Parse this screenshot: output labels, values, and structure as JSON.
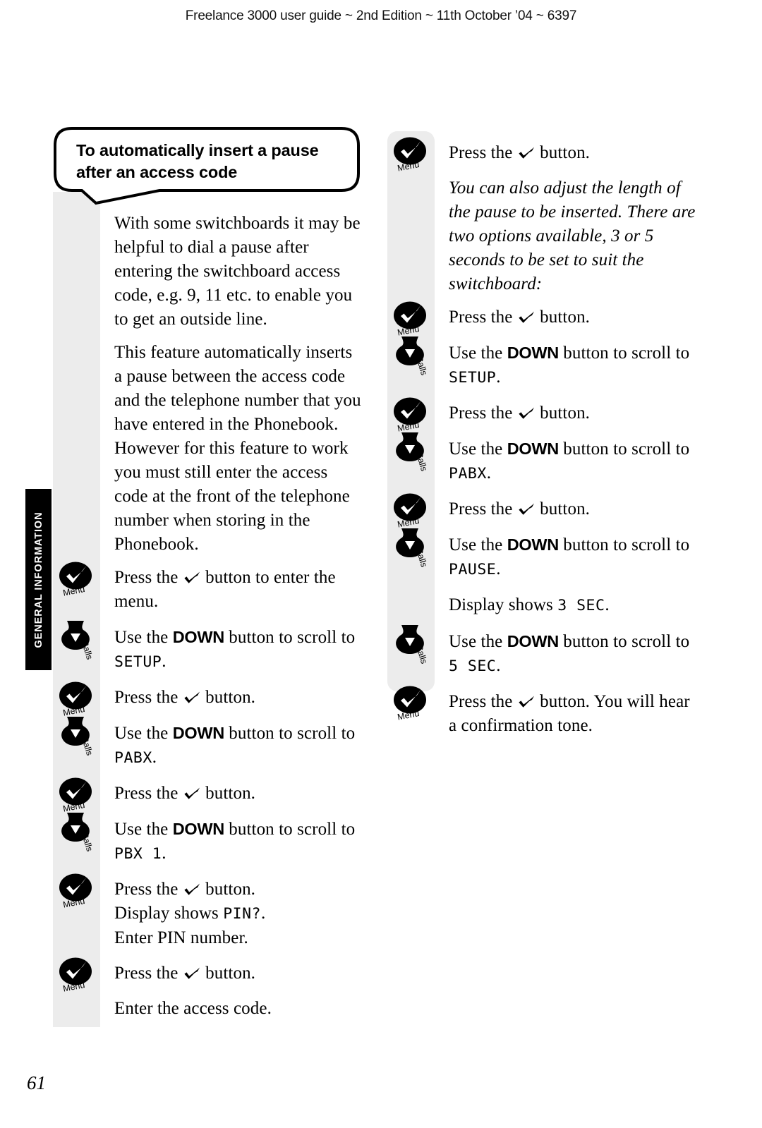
{
  "header": {
    "running_head": "Freelance 3000 user guide ~ 2nd Edition ~ 11th October ’04 ~ 6397"
  },
  "section_tab": {
    "label": "GENERAL INFORMATION"
  },
  "callout": {
    "title": "To automatically insert a pause after an access code"
  },
  "icons": {
    "menu": {
      "name": "menu-tick-icon",
      "caption": "Menu"
    },
    "down": {
      "name": "down-arrow-icon",
      "caption": "Calls"
    }
  },
  "left_column": {
    "intro_1": "With some switchboards it may be helpful to dial a pause after entering the switchboard access code, e.g. 9, 11 etc. to enable you to get an outside line.",
    "intro_2": "This feature automatically inserts a pause between the access code and the telephone number that you have entered in the Phonebook. However for this feature to work you must still enter the access code at the front of the telephone number when storing in the Phonebook.",
    "steps": [
      {
        "icon": "menu",
        "pre": "Press the ",
        "post": " button to enter the menu."
      },
      {
        "icon": "down",
        "pre": "Use the ",
        "bold": "DOWN",
        "post": " button to scroll to ",
        "lcd": "SETUP",
        "tail": "."
      },
      {
        "icon": "menu",
        "pre": "Press the ",
        "post": " button."
      },
      {
        "icon": "down",
        "pre": "Use the ",
        "bold": "DOWN",
        "post": " button to scroll to ",
        "lcd": "PABX",
        "tail": "."
      },
      {
        "icon": "menu",
        "pre": "Press the ",
        "post": " button."
      },
      {
        "icon": "down",
        "pre": "Use the ",
        "bold": "DOWN",
        "post": " button to scroll to ",
        "lcd": "PBX  1",
        "tail": "."
      },
      {
        "icon": "menu",
        "pre": "Press the ",
        "post": " button.",
        "line2_pre": "Display shows ",
        "line2_lcd": "PIN?",
        "line2_tail": ".",
        "line3": "Enter PIN number."
      },
      {
        "icon": "menu",
        "pre": "Press the ",
        "post": " button."
      },
      {
        "icon": null,
        "plain": "Enter the access code."
      }
    ]
  },
  "right_column": {
    "steps": [
      {
        "icon": "menu",
        "pre": "Press the ",
        "post": " button."
      },
      {
        "icon": null,
        "italic": "You can also adjust the length of the pause to be inserted. There are two options available, 3 or 5 seconds to be set to suit the switchboard:"
      },
      {
        "icon": "menu",
        "pre": "Press the ",
        "post": " button."
      },
      {
        "icon": "down",
        "pre": "Use the ",
        "bold": "DOWN",
        "post": " button to scroll to ",
        "lcd": "SETUP",
        "tail": "."
      },
      {
        "icon": "menu",
        "pre": "Press the ",
        "post": " button."
      },
      {
        "icon": "down",
        "pre": "Use the ",
        "bold": "DOWN",
        "post": " button to scroll to ",
        "lcd": "PABX",
        "tail": "."
      },
      {
        "icon": "menu",
        "pre": "Press the ",
        "post": " button."
      },
      {
        "icon": "down",
        "pre": "Use the ",
        "bold": "DOWN",
        "post": " button to scroll to ",
        "lcd": "PAUSE",
        "tail": "."
      },
      {
        "icon": null,
        "pre": "Display shows ",
        "lcd": "3  SEC",
        "tail": "."
      },
      {
        "icon": "down",
        "pre": "Use the ",
        "bold": "DOWN",
        "post": " button to scroll to ",
        "lcd": "5  SEC",
        "tail": "."
      },
      {
        "icon": "menu",
        "pre": "Press the ",
        "post": " button. You will hear a confirmation tone."
      }
    ]
  },
  "folio": {
    "page_number": "61"
  },
  "colors": {
    "rail": "#ececec",
    "tab": "#000000",
    "ink": "#000000",
    "paper": "#ffffff"
  }
}
